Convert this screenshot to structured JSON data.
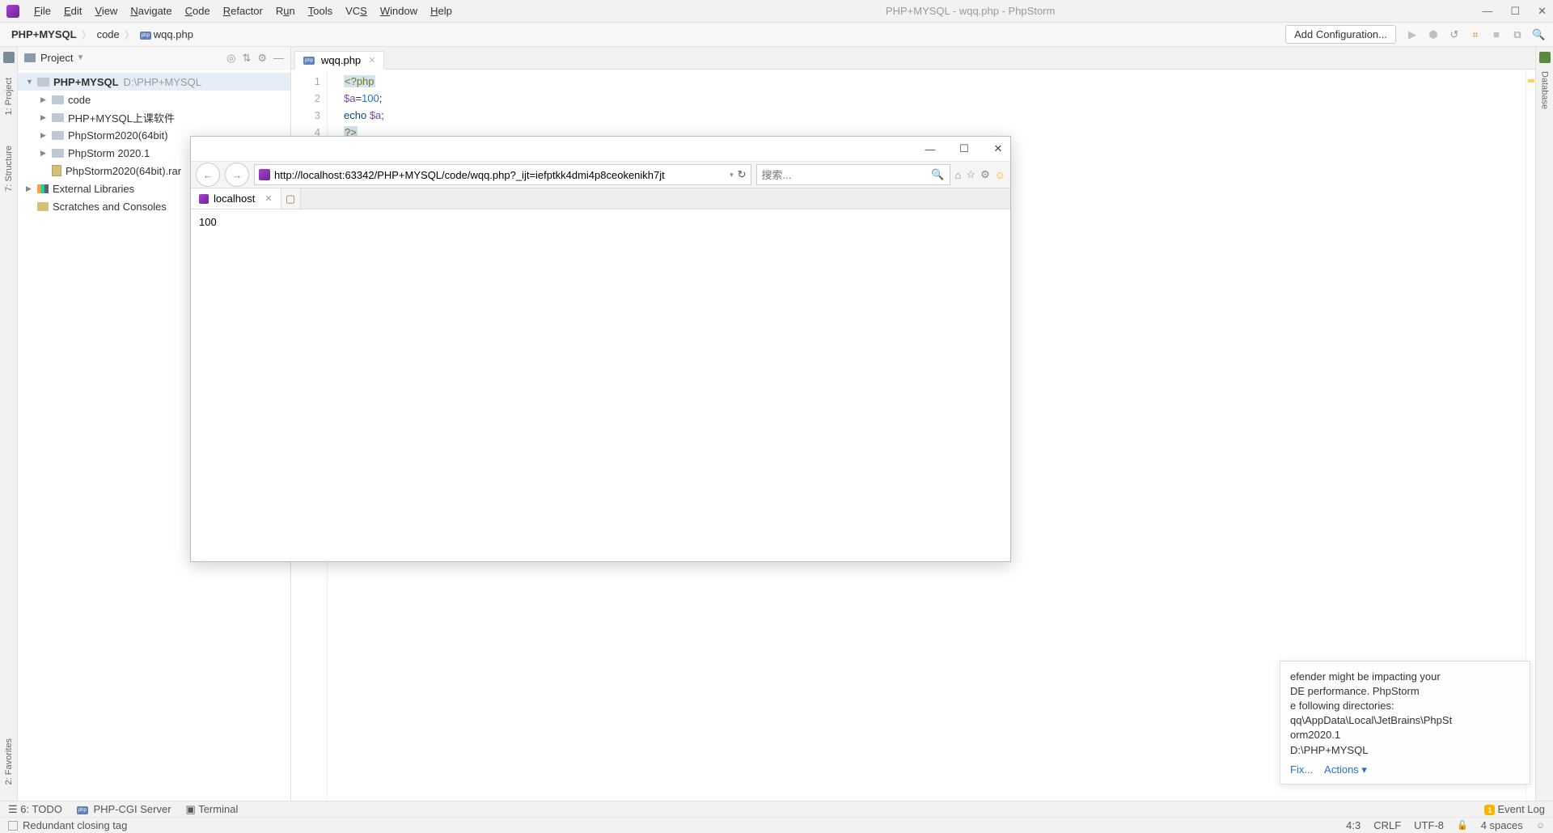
{
  "window": {
    "title": "PHP+MYSQL - wqq.php - PhpStorm",
    "minimize": "—",
    "maximize": "☐",
    "close": "✕"
  },
  "menu": [
    "File",
    "Edit",
    "View",
    "Navigate",
    "Code",
    "Refactor",
    "Run",
    "Tools",
    "VCS",
    "Window",
    "Help"
  ],
  "breadcrumb": {
    "root": "PHP+MYSQL",
    "mid": "code",
    "file": "wqq.php"
  },
  "toolbar": {
    "add_config": "Add Configuration...",
    "run": "▶",
    "debug": "⬢",
    "cover": "↺",
    "struct": "⌗",
    "stop": "■",
    "wrap": "⧉",
    "search": "🔍"
  },
  "left_tabs": {
    "project": "1: Project",
    "structure": "7: Structure",
    "favorites": "2: Favorites"
  },
  "right_tabs": {
    "database": "Database"
  },
  "project_panel": {
    "title": "Project",
    "icons": [
      "◎",
      "⇅",
      "⚙",
      "—"
    ]
  },
  "tree": {
    "root": {
      "name": "PHP+MYSQL",
      "path": "D:\\PHP+MYSQL"
    },
    "items": [
      {
        "label": "code"
      },
      {
        "label": "PHP+MYSQL上课软件"
      },
      {
        "label": "PhpStorm2020(64bit)"
      },
      {
        "label": "PhpStorm 2020.1"
      },
      {
        "label": "PhpStorm2020(64bit).rar",
        "icon": "rar"
      }
    ],
    "external": "External Libraries",
    "scratches": "Scratches and Consoles"
  },
  "editor": {
    "tab": "wqq.php",
    "lines": [
      "1",
      "2",
      "3",
      "4"
    ],
    "code": {
      "l1": "<?php",
      "l2_var": "$a",
      "l2_eq": "=",
      "l2_num": "100",
      "l2_semi": ";",
      "l3_kw": "echo",
      "l3_var": "$a",
      "l3_semi": ";",
      "l4": "?>"
    }
  },
  "browser": {
    "url": "http://localhost:63342/PHP+MYSQL/code/wqq.php?_ijt=iefptkk4dmi4p8ceokenikh7jt",
    "search_placeholder": "搜索...",
    "tab_title": "localhost",
    "output": "100",
    "win": {
      "min": "—",
      "max": "☐",
      "close": "✕"
    },
    "nav": {
      "back": "←",
      "fwd": "→",
      "dd": "▾",
      "reload": "↻"
    },
    "icons": {
      "home": "⌂",
      "star": "☆",
      "gear": "⚙",
      "smile": "☺"
    },
    "search_mag": "🔍"
  },
  "notification": {
    "line1": "efender might be impacting your",
    "line2": "DE performance. PhpStorm",
    "line3": "e following directories:",
    "line4": "qq\\AppData\\Local\\JetBrains\\PhpSt",
    "line5": "orm2020.1",
    "line6": "D:\\PHP+MYSQL",
    "fix": "Fix...",
    "actions": "Actions ▾"
  },
  "tool_windows": {
    "todo": "6: TODO",
    "phpcgi": "PHP-CGI Server",
    "terminal": "Terminal",
    "eventlog": "Event Log",
    "evt_badge": "1"
  },
  "status": {
    "hint": "Redundant closing tag",
    "pos": "4:3",
    "eol": "CRLF",
    "enc": "UTF-8",
    "indent": "4 spaces"
  }
}
